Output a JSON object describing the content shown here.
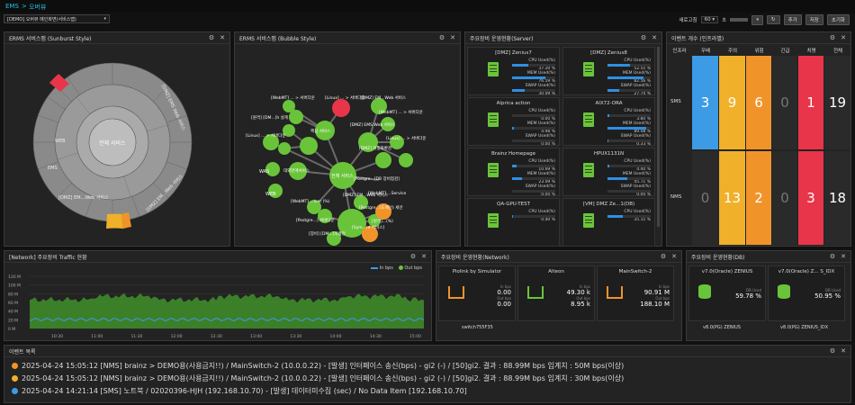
{
  "breadcrumb": {
    "root": "EMS",
    "sep": ">",
    "page": "오버뷰"
  },
  "toolbar": {
    "map_select": "[DEMO] 오버뷰 메인화면(서비스맵)",
    "refresh_label": "새로고침",
    "refresh_value": "60",
    "refresh_unit": "초",
    "add": "추가",
    "save": "저장",
    "reset": "초기화"
  },
  "colors": {
    "accent": "#24c4e0",
    "green": "#6ac43a",
    "orange": "#f0942a",
    "red": "#e8354a",
    "blue": "#3d9be6"
  },
  "sunburst": {
    "title": "ERMS 서비스맵 (Sunburst Style)",
    "center": "전체 서비스",
    "labels": [
      "[DMZ] EMS Web 서비스",
      "[DMZ] EM...Web 서비스",
      "[DMZ] EM...Web 서비스",
      "EMS",
      "WEB"
    ]
  },
  "bubble": {
    "title": "ERMS 서비스맵 (Bubble Style)",
    "nodes": [
      "[WebMT] ... > 서버다운",
      "[Linux] ... > 서버다운",
      "[DMZ] EM...Web 서비스",
      "[WebMT] ... > 서버다운",
      "[원격] [DM...]h 설계",
      "핵심 서비스",
      "[DMZ] EMS Web 서비스",
      "[Linux] ... > 서버다운",
      "[Linux] ... > 서버다운",
      "[DMZ] 이중화환경",
      "전체 서비스",
      "WAS",
      "대외연계서비스",
      "[Postgre...[DB 장비점검]",
      "[DMZ] EM...Web 서비스",
      "WEB",
      "[WebMT] ...iver (%)",
      "[WebMT] ...Service",
      "[Postgre...(도메인) 세션",
      "[Postgre...] 서버다운",
      "[원격]...(%)",
      "[Sym...nt 서비스]",
      "[장비] [DM...]의점검"
    ]
  },
  "server": {
    "title": "주요장비 운영현황(Server)",
    "cards": [
      {
        "name": "[DMZ] Zenius7",
        "cpu": "37.20 %",
        "mem": "76.59 %",
        "swap": "30.09 %"
      },
      {
        "name": "[DMZ] Zenius8",
        "cpu": "52.55 %",
        "mem": "82.56 %",
        "swap": "27.74 %"
      },
      {
        "name": "Alprica action",
        "cpu": "0.00 %",
        "mem": "4.98 %",
        "swap": "0.00 %"
      },
      {
        "name": "AIX72-ORA",
        "cpu": "3.80 %",
        "mem": "89.08 %",
        "swap": "0.33 %"
      },
      {
        "name": "Brainz Homepage",
        "cpu": "10.69 %",
        "mem": "23.09 %",
        "swap": "0.00 %"
      },
      {
        "name": "HPUX1131N",
        "cpu": "4.40 %",
        "mem": "45.71 %",
        "swap": "0.00 %"
      },
      {
        "name": "QA-GPU-TEST",
        "cpu": "0.40 %",
        "mem": "",
        "swap": ""
      },
      {
        "name": "[VM] DMZ Ze...1(DB)",
        "cpu": "35.15 %",
        "mem": "",
        "swap": ""
      }
    ],
    "labels": {
      "cpu": "CPU Used(%)",
      "mem": "MEM Used(%)",
      "swap": "SWAP Used(%)"
    }
  },
  "events_count": {
    "title": "이벤트 개수 (인프라별)",
    "headers": [
      "인프라",
      "우배",
      "주의",
      "위험",
      "긴급",
      "치명",
      "전체"
    ],
    "rows": [
      {
        "infra": "SMS",
        "values": [
          "3",
          "9",
          "6",
          "0",
          "1",
          "19"
        ]
      },
      {
        "infra": "NMS",
        "values": [
          "0",
          "13",
          "2",
          "0",
          "3",
          "18"
        ]
      }
    ]
  },
  "traffic": {
    "title": "[Network] 주요장비 Traffic 현황",
    "legend_in": "In bps",
    "legend_out": "Out bps",
    "yticks": [
      "120 M",
      "100 M",
      "80 M",
      "60 M",
      "40 M",
      "20 M",
      "0 M"
    ],
    "xticks": [
      "10:30",
      "11:00",
      "11:30",
      "12:00",
      "12:30",
      "13:00",
      "13:30",
      "14:00",
      "14:30",
      "15:00"
    ]
  },
  "network": {
    "title": "주요장비 운영현황(Network)",
    "cards": [
      {
        "name": "Piolink by Simulator",
        "in": "0.00",
        "out": "0.00"
      },
      {
        "name": "Alteon",
        "in": "49.30 k",
        "out": "8.95 k"
      },
      {
        "name": "MainSwitch-2",
        "in": "90.91 M",
        "out": "188.10 M"
      }
    ],
    "in_label": "In bps",
    "out_label": "Out bps",
    "extra": "switch755F35"
  },
  "db": {
    "title": "주요장비 운영현황(DB)",
    "cards": [
      {
        "name": "v7.0(Oracle) ZENIUS",
        "value": "59.78 %",
        "label": "DB Used"
      },
      {
        "name": "v7.0(Oracle) Z... S_IDX",
        "value": "50.95 %",
        "label": "DB Used"
      }
    ],
    "extra": [
      "v8.0(PG) ZENIUS",
      "v8.0(PG) ZENIUS_IDX"
    ]
  },
  "eventlist": {
    "title": "이벤트 목록",
    "items": [
      {
        "color": "#f0942a",
        "text": "2025-04-24 15:05:12 [NMS] brainz > DEMO용(사용금지!!) / MainSwitch-2 (10.0.0.22) - [발생] 인터페이스 송신(bps) - gi2 (-) / [50]gi2. 결과 : 88.99M bps 임계치 : 50M bps(이상)"
      },
      {
        "color": "#f0b02a",
        "text": "2025-04-24 15:05:12 [NMS] brainz > DEMO용(사용금지!!) / MainSwitch-2 (10.0.0.22) - [발생] 인터페이스 송신(bps) - gi2 (-) / [50]gi2. 결과 : 88.99M bps 임계치 : 30M bps(이상)"
      },
      {
        "color": "#3d9be6",
        "text": "2025-04-24 14:21:14 [SMS] 노트북 / 02020396-HJH (192.168.10.70) - [발생] 데이터미수집 (sec) / No Data Item [192.168.10.70]"
      }
    ]
  }
}
